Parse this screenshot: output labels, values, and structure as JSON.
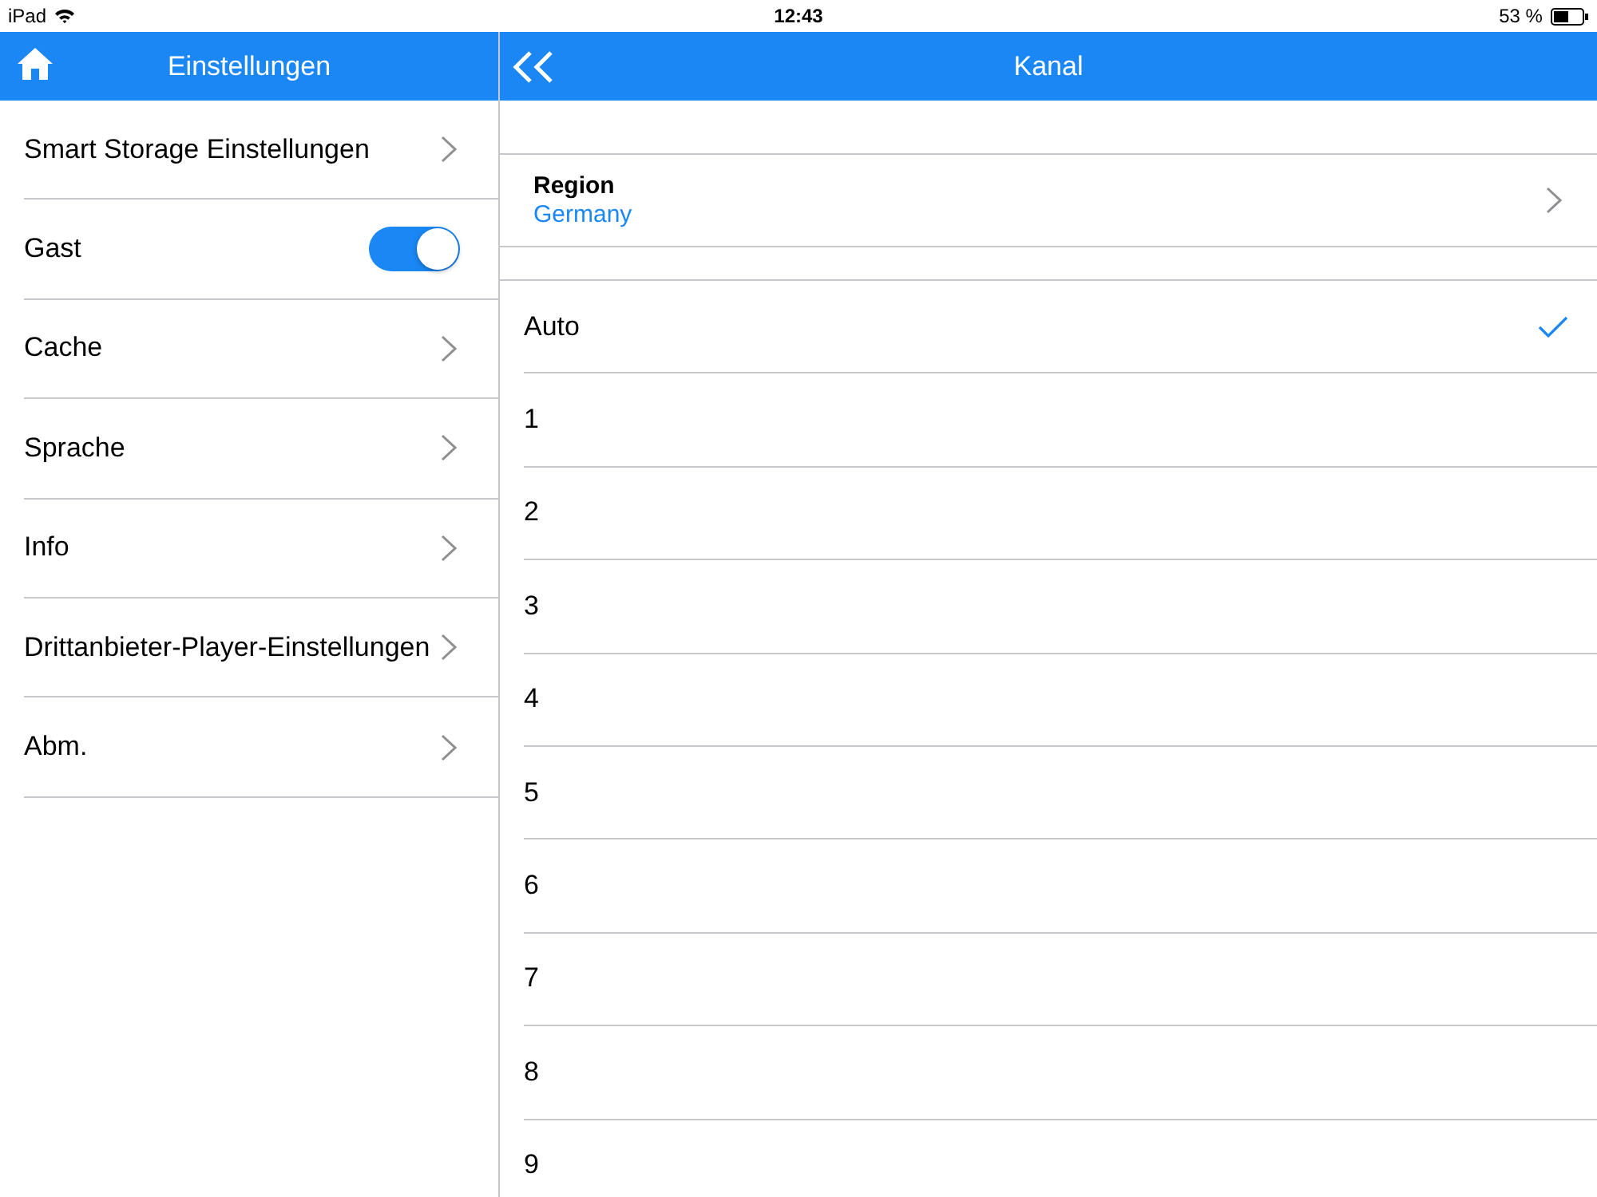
{
  "status_bar": {
    "device": "iPad",
    "time": "12:43",
    "battery": "53 %"
  },
  "sidebar": {
    "title": "Einstellungen",
    "items": [
      {
        "label": "Smart Storage Einstellungen",
        "kind": "link"
      },
      {
        "label": "Gast",
        "kind": "toggle",
        "on": true
      },
      {
        "label": "Cache",
        "kind": "link"
      },
      {
        "label": "Sprache",
        "kind": "link"
      },
      {
        "label": "Info",
        "kind": "link"
      },
      {
        "label": "Drittanbieter-Player-Einstellungen",
        "kind": "link"
      },
      {
        "label": "Abm.",
        "kind": "link"
      }
    ]
  },
  "detail": {
    "title": "Kanal",
    "region": {
      "label": "Region",
      "value": "Germany"
    },
    "channels": [
      {
        "label": "Auto",
        "selected": true
      },
      {
        "label": "1",
        "selected": false
      },
      {
        "label": "2",
        "selected": false
      },
      {
        "label": "3",
        "selected": false
      },
      {
        "label": "4",
        "selected": false
      },
      {
        "label": "5",
        "selected": false
      },
      {
        "label": "6",
        "selected": false
      },
      {
        "label": "7",
        "selected": false
      },
      {
        "label": "8",
        "selected": false
      },
      {
        "label": "9",
        "selected": false
      }
    ]
  }
}
